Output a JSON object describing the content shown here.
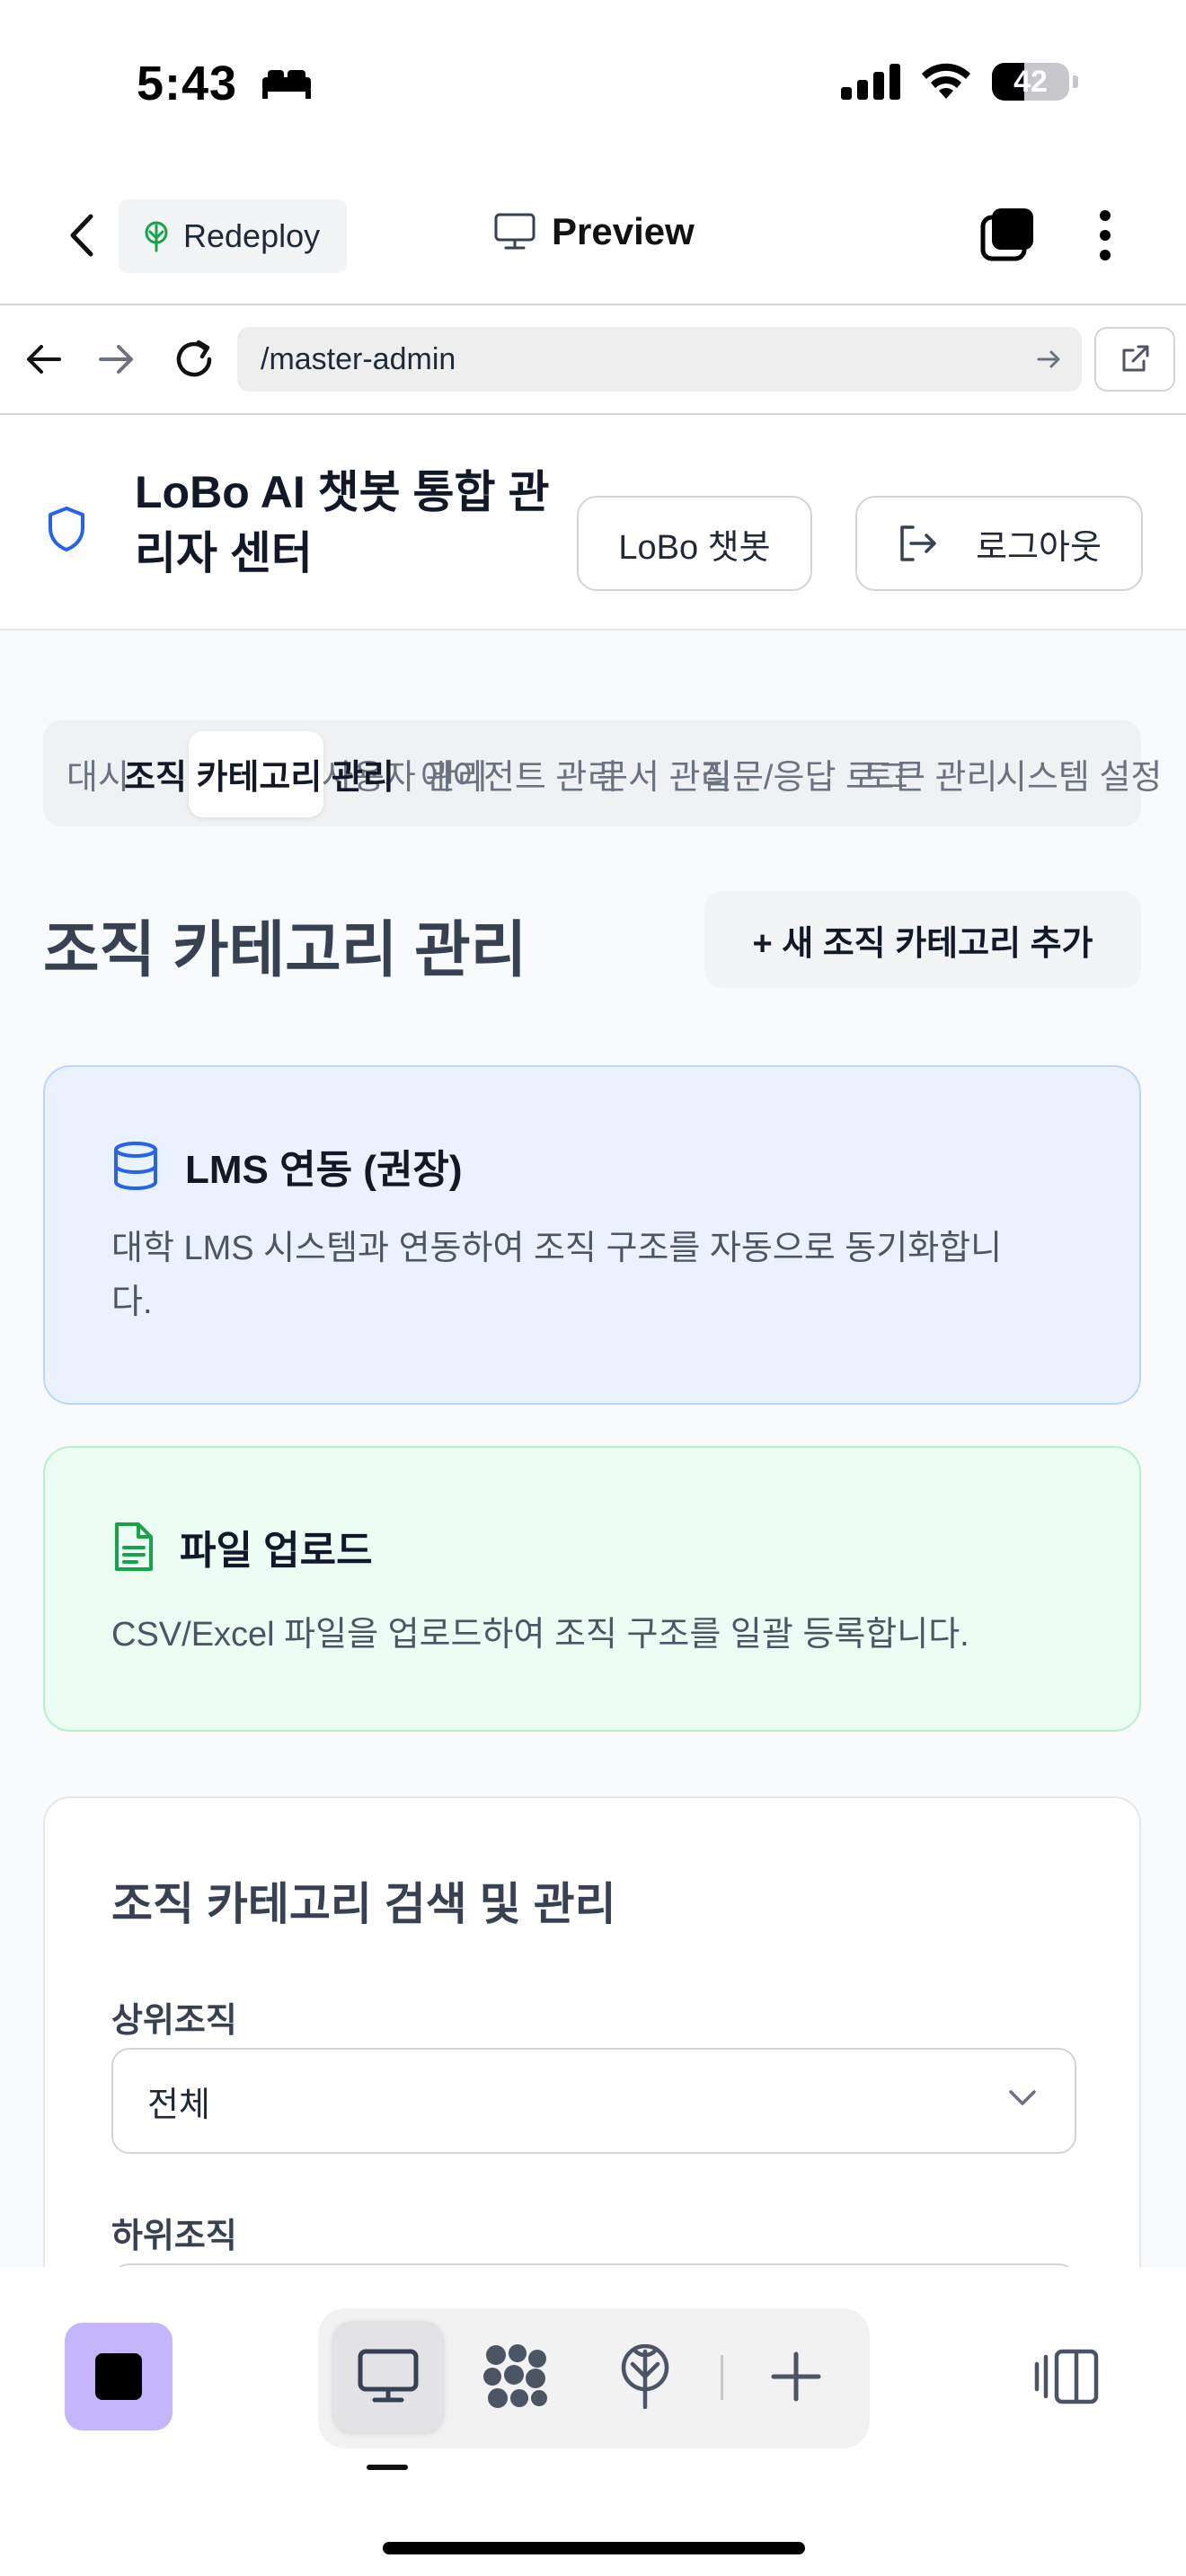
{
  "status_bar": {
    "time": "5:43",
    "battery": "42",
    "battery_level": 0.42
  },
  "app_header": {
    "redeploy_label": "Redeploy",
    "preview_label": "Preview"
  },
  "browser": {
    "url": "/master-admin"
  },
  "site": {
    "title": "LoBo AI 챗봇 통합 관리자 센터",
    "chatbot_button": "LoBo 챗봇",
    "logout_button": "로그아웃"
  },
  "tabs": [
    {
      "label": "대시"
    },
    {
      "label": "조직 카테고리 관리"
    },
    {
      "label": "사용자 관리"
    },
    {
      "label": "에이전트 관리"
    },
    {
      "label": "문서 관리"
    },
    {
      "label": "질문/응답 로그"
    },
    {
      "label": "토큰 관리"
    },
    {
      "label": "시스템 설정"
    }
  ],
  "main": {
    "heading": "조직 카테고리 관리",
    "add_button": "+ 새 조직 카테고리 추가",
    "lms_card": {
      "title": "LMS 연동 (권장)",
      "desc_line1": "대학 LMS 시스템과 연동하여 조직 구조를 자동으로 동기화합니",
      "desc_line2": "다."
    },
    "file_card": {
      "title": "파일 업로드",
      "desc": "CSV/Excel 파일을 업로드하여 조직 구조를 일괄 등록합니다."
    },
    "search_card": {
      "title": "조직 카테고리 검색 및 관리",
      "parent_label": "상위조직",
      "parent_value": "전체",
      "child_label": "하위조직"
    }
  },
  "colors": {
    "accent": "#2563eb",
    "success": "#16a34a",
    "stop_button": "#c4b5fd"
  },
  "icons": [
    "chevron-left-icon",
    "tree-icon",
    "monitor-icon",
    "tabs-icon",
    "more-vertical-icon",
    "arrow-left-icon",
    "arrow-right-icon",
    "reload-icon",
    "external-link-icon",
    "shield-icon",
    "logout-icon",
    "database-icon",
    "file-text-icon",
    "chevron-down-icon",
    "grid-blob-icon",
    "plus-icon",
    "panel-icon"
  ]
}
